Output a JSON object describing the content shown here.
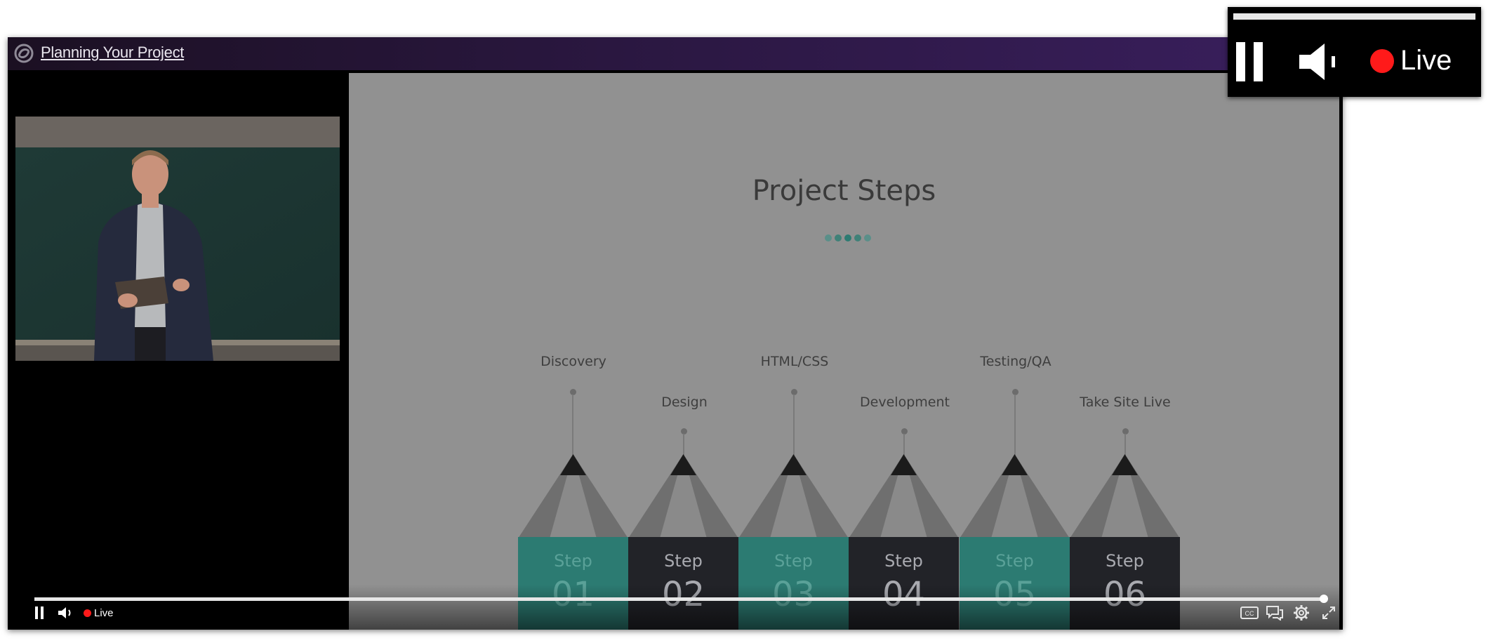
{
  "window": {
    "title": "Planning Your Project"
  },
  "slide": {
    "title": "Project Steps",
    "steps": [
      {
        "label": "Discovery",
        "step_word": "Step",
        "number": "01",
        "color": "#2c7b72"
      },
      {
        "label": "Design",
        "step_word": "Step",
        "number": "02",
        "color": "#222328"
      },
      {
        "label": "HTML/CSS",
        "step_word": "Step",
        "number": "03",
        "color": "#2c7b72"
      },
      {
        "label": "Development",
        "step_word": "Step",
        "number": "04",
        "color": "#222328"
      },
      {
        "label": "Testing/QA",
        "step_word": "Step",
        "number": "05",
        "color": "#2c7b72"
      },
      {
        "label": "Take Site Live",
        "step_word": "Step",
        "number": "06",
        "color": "#222328"
      }
    ]
  },
  "controls": {
    "live_label": "Live",
    "progress": 0.99,
    "icons": [
      "pause-icon",
      "volume-icon",
      "live-dot-icon",
      "closed-captions-icon",
      "chat-icon",
      "settings-icon",
      "fullscreen-icon"
    ]
  },
  "zoom_inset": {
    "live_label": "Live",
    "icons": [
      "pause-icon",
      "volume-icon",
      "live-dot-icon"
    ]
  },
  "colors": {
    "titlebar": "#2a1740",
    "teal": "#2c7b72",
    "dark": "#222328",
    "live": "#ff1a1a"
  }
}
